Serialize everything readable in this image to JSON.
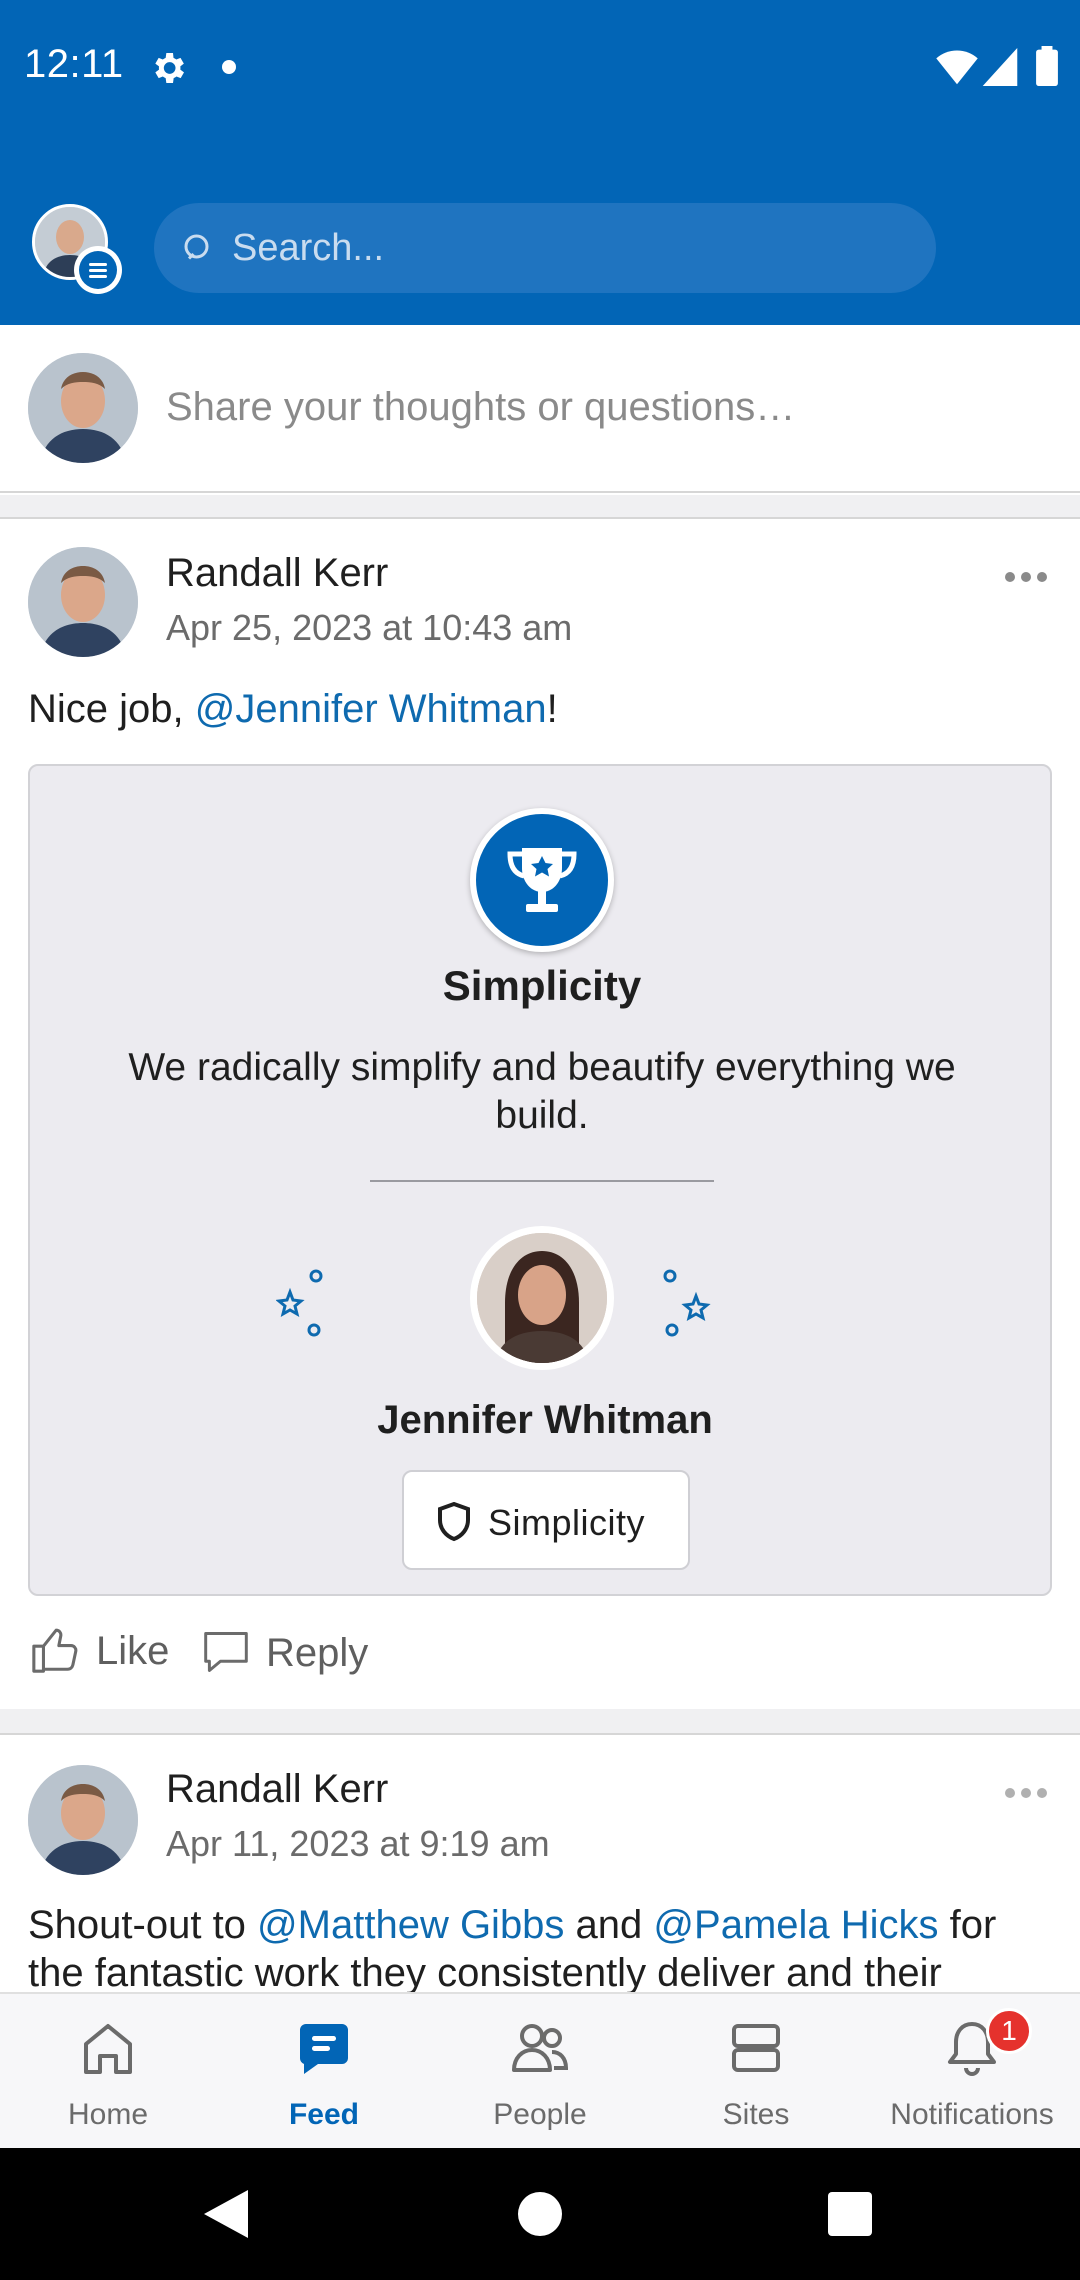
{
  "status_bar": {
    "time": "12:11"
  },
  "header": {
    "search_placeholder": "Search..."
  },
  "composer": {
    "placeholder": "Share your thoughts or questions…"
  },
  "posts": [
    {
      "author": "Randall Kerr",
      "date": "Apr 25, 2023 at 10:43 am",
      "body_prefix": "Nice job, ",
      "mention": "@Jennifer Whitman",
      "body_suffix": "!",
      "award": {
        "title": "Simplicity",
        "description": "We radically simplify and beautify everything we build.",
        "recipient": "Jennifer Whitman",
        "badge_label": "Simplicity"
      },
      "actions": {
        "like": "Like",
        "reply": "Reply"
      }
    },
    {
      "author": "Randall Kerr",
      "date": "Apr 11, 2023 at 9:19 am",
      "body_1": "Shout-out to ",
      "mention_1": "@Matthew Gibbs",
      "body_2": " and ",
      "mention_2": "@Pamela Hicks",
      "body_3": " for the fantastic work they consistently deliver and their"
    }
  ],
  "bottom_nav": {
    "items": [
      {
        "label": "Home",
        "icon": "home-icon"
      },
      {
        "label": "Feed",
        "icon": "feed-icon",
        "active": true
      },
      {
        "label": "People",
        "icon": "people-icon"
      },
      {
        "label": "Sites",
        "icon": "sites-icon"
      },
      {
        "label": "Notifications",
        "icon": "bell-icon",
        "badge": "1"
      }
    ]
  },
  "colors": {
    "brand": "#0265b6",
    "mention": "#0e6aaf",
    "badge": "#e5322d"
  }
}
